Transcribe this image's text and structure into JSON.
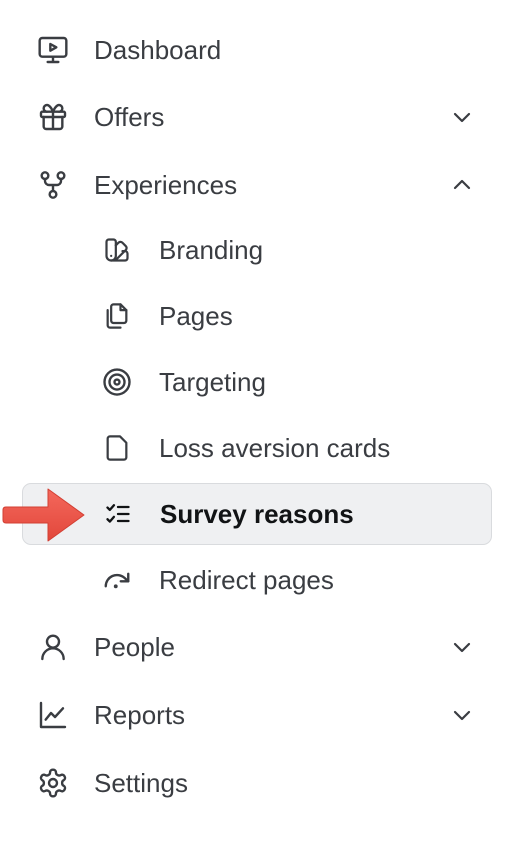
{
  "nav": {
    "dashboard": {
      "label": "Dashboard",
      "icon": "monitor-play-icon"
    },
    "offers": {
      "label": "Offers",
      "icon": "gift-icon",
      "expanded": false
    },
    "experiences": {
      "label": "Experiences",
      "icon": "branch-icon",
      "expanded": true,
      "children": {
        "branding": {
          "label": "Branding",
          "icon": "swatch-book-icon"
        },
        "pages": {
          "label": "Pages",
          "icon": "files-icon"
        },
        "targeting": {
          "label": "Targeting",
          "icon": "target-icon"
        },
        "loss_aversion_cards": {
          "label": "Loss aversion cards",
          "icon": "file-icon"
        },
        "survey_reasons": {
          "label": "Survey reasons",
          "icon": "list-checks-icon",
          "active": true
        },
        "redirect_pages": {
          "label": "Redirect pages",
          "icon": "redo-icon"
        }
      }
    },
    "people": {
      "label": "People",
      "icon": "user-icon",
      "expanded": false
    },
    "reports": {
      "label": "Reports",
      "icon": "line-chart-icon",
      "expanded": false
    },
    "settings": {
      "label": "Settings",
      "icon": "gear-icon"
    }
  },
  "colors": {
    "text": "#3a3d42",
    "active_text": "#111315",
    "active_bg": "#eff0f2",
    "arrow": "#ee5145"
  }
}
